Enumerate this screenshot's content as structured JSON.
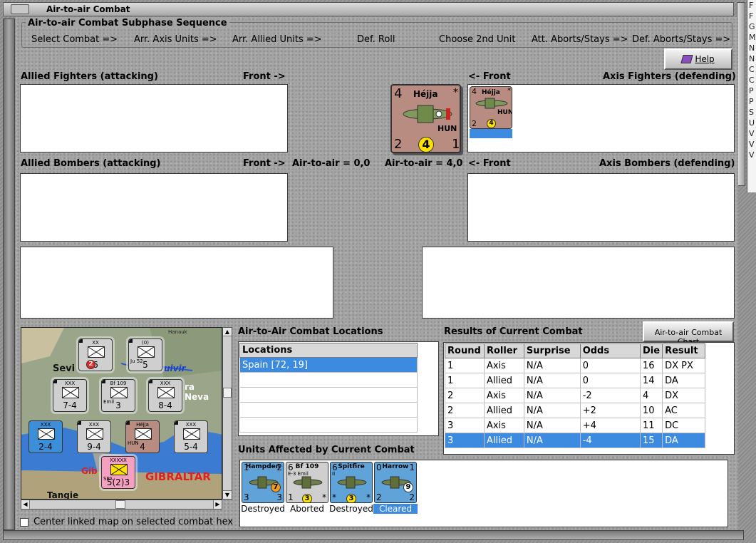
{
  "window": {
    "title": "Air-to-air Combat"
  },
  "right_strip_letters": [
    "F",
    "F",
    "G",
    "M",
    "N",
    "N",
    "C",
    "C",
    "P",
    "P",
    "S",
    "U",
    "V",
    "V",
    "V"
  ],
  "phase": {
    "title": "Air-to-air Combat Subphase Sequence",
    "steps": [
      "Select Combat =>",
      "Arr. Axis Units =>",
      "Arr. Allied Units =>",
      "Def. Roll",
      "Choose 2nd Unit",
      "Att. Aborts/Stays =>",
      "Def. Aborts/Stays =>"
    ]
  },
  "help_button": {
    "label": "Help",
    "icon": "help-book-icon"
  },
  "sections": {
    "allied_fighters": "Allied Fighters (attacking)",
    "allied_front": "Front ->",
    "axis_front": "<- Front",
    "axis_fighters": "Axis Fighters (defending)",
    "allied_bombers": "Allied Bombers (attacking)",
    "allied_bombers_front": "Front ->",
    "axis_bombers_front": "<- Front",
    "axis_bombers": "Axis Bombers (defending)",
    "allied_a2a": "Air-to-air = 0,0",
    "axis_a2a": "Air-to-air = 4,0"
  },
  "big_counter": {
    "name": "Héjja",
    "nation": "HUN",
    "air_attack": "4",
    "air_defense": "2",
    "range": "4",
    "move": "1",
    "star": "*"
  },
  "small_counter": {
    "name": "Héjja",
    "nation": "HUN",
    "air_attack": "4",
    "air_defense": "2",
    "range": "4",
    "star": "*"
  },
  "map": {
    "labels": {
      "seville": "Sevi",
      "guadalq": "uivir",
      "sierra": "ra Neva",
      "gibraltar_short": "Gib",
      "gibraltar": "GIBRALTAR",
      "tangier": "Tangie",
      "town": "Hanauk"
    },
    "units": [
      {
        "top": "XX",
        "value": "6",
        "dot": "2",
        "stack": "3"
      },
      {
        "top": "(0)",
        "value": "5",
        "sub": "Ju 52",
        "stack": "3"
      },
      {
        "top": "XXX",
        "value": "7-4",
        "stack": "4"
      },
      {
        "top": "Bf 109",
        "value": "3",
        "sub": "Emil",
        "stack": "6"
      },
      {
        "top": "XXX",
        "value": "8-4",
        "stack": "2"
      },
      {
        "top": "XXX",
        "value": "2-4",
        "stack": ""
      },
      {
        "top": "XXX",
        "value": "9-4",
        "stack": "2"
      },
      {
        "top": "Héjja",
        "value": "4",
        "sub": "HUN",
        "stack": "5"
      },
      {
        "top": "XXX",
        "value": "5-4",
        "stack": "3"
      },
      {
        "top": "XXXXX",
        "value": "5(2)3",
        "sub": "SPA",
        "stack": ""
      }
    ]
  },
  "center_checkbox": {
    "label": "Center linked map on selected combat hex",
    "checked": false
  },
  "locations": {
    "title": "Air-to-Air Combat Locations",
    "header": "Locations",
    "rows": [
      "Spain [72, 19]",
      "",
      "",
      "",
      ""
    ]
  },
  "results": {
    "title": "Results of Current Combat",
    "chart_button": "Air-to-air Combat Chart",
    "columns": [
      "Round",
      "Roller",
      "Surprise",
      "Odds",
      "Die",
      "Result"
    ],
    "rows": [
      [
        "1",
        "Axis",
        "N/A",
        "0",
        "16",
        "DX PX"
      ],
      [
        "1",
        "Allied",
        "N/A",
        "0",
        "14",
        "DA"
      ],
      [
        "2",
        "Axis",
        "N/A",
        "-2",
        "4",
        "DX"
      ],
      [
        "2",
        "Allied",
        "N/A",
        "+2",
        "10",
        "AC"
      ],
      [
        "3",
        "Axis",
        "N/A",
        "+4",
        "11",
        "DC"
      ],
      [
        "3",
        "Allied",
        "N/A",
        "-4",
        "15",
        "DA"
      ]
    ],
    "selected_row": 5
  },
  "affected": {
    "title": "Units Affected by Current Combat",
    "units": [
      {
        "name": "Hampden",
        "tl": "1",
        "tr": "2",
        "bl": "3",
        "br": "3",
        "dot": "7",
        "status": "Destroyed",
        "bg": "#5fa3d8"
      },
      {
        "name": "Bf 109",
        "sub": "E-3 Emil",
        "tl": "6",
        "tr": "",
        "bl": "1",
        "br": "*",
        "dot": "3",
        "status": "Aborted",
        "bg": "#cfcfcf"
      },
      {
        "name": "Spitfire",
        "sub": "II",
        "tl": "6",
        "tr": "",
        "bl": "*",
        "br": "*",
        "dot": "3",
        "status": "Destroyed",
        "bg": "#5fa3d8"
      },
      {
        "name": "Harrow",
        "tl": "0",
        "tr": "1",
        "bl": "2",
        "br": "2",
        "dot": "9",
        "status": "Cleared",
        "bg": "#5fa3d8"
      }
    ],
    "selected_index": 3
  }
}
